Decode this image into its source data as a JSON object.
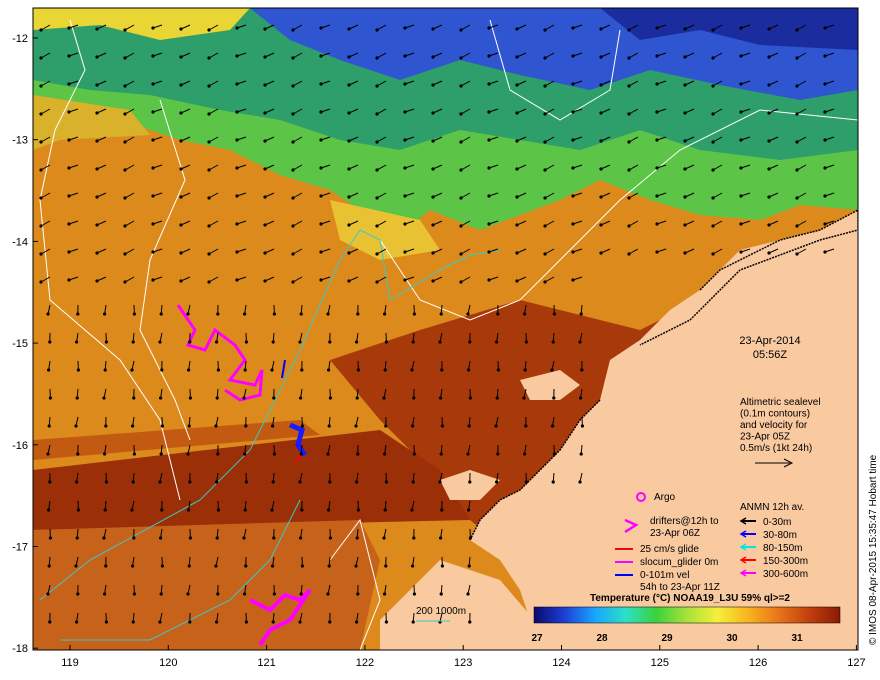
{
  "axes": {
    "lat_ticks": [
      "-12",
      "-13",
      "-14",
      "-15",
      "-16",
      "-17",
      "-18"
    ],
    "lon_ticks": [
      "119",
      "120",
      "121",
      "122",
      "123",
      "124",
      "125",
      "126",
      "127"
    ]
  },
  "map_info": {
    "date": "23-Apr-2014",
    "time": "05:56Z",
    "altimetric_lines": [
      "Altimetric sealevel",
      "(0.1m contours)",
      "and velocity for",
      "23-Apr 05Z",
      "0.5m/s (1kt 24h)"
    ],
    "scale_label": "200  1000m"
  },
  "legend": {
    "argo": "Argo",
    "drifters": [
      "drifters@12h to",
      "23-Apr 06Z"
    ],
    "glide": "25 cm/s glide",
    "slocum": "slocum_glider 0m",
    "vel": [
      "0-101m vel",
      "54h to 23-Apr 11Z"
    ],
    "anmn_title": "ANMN 12h av.",
    "anmn": [
      {
        "label": "0-30m",
        "color": "#000000"
      },
      {
        "label": "30-80m",
        "color": "#0000ff"
      },
      {
        "label": "80-150m",
        "color": "#00e5e5"
      },
      {
        "label": "150-300m",
        "color": "#ff0000"
      },
      {
        "label": "300-600m",
        "color": "#ff00ff"
      }
    ]
  },
  "colorbar": {
    "title": "Temperature (°C) NOAA19_L3U 59% ql>=2",
    "ticks": [
      "27",
      "28",
      "29",
      "30",
      "31"
    ],
    "stops": [
      "#0a0a6e",
      "#1d3fd6",
      "#18a6ff",
      "#2ce0c8",
      "#3bd23b",
      "#a7e23a",
      "#f5f03a",
      "#f8b41e",
      "#e8741a",
      "#c23f0c",
      "#8a1a06"
    ]
  },
  "credit": "© IMOS 08-Apr-2015 15:35:47 Hobart time",
  "colors": {
    "land": "#f9c9a0",
    "warm_sea": "#d97d19",
    "hot_sea": "#a8390b",
    "cool_sea": "#2aa84a",
    "cold_sea": "#1f3fcf"
  }
}
